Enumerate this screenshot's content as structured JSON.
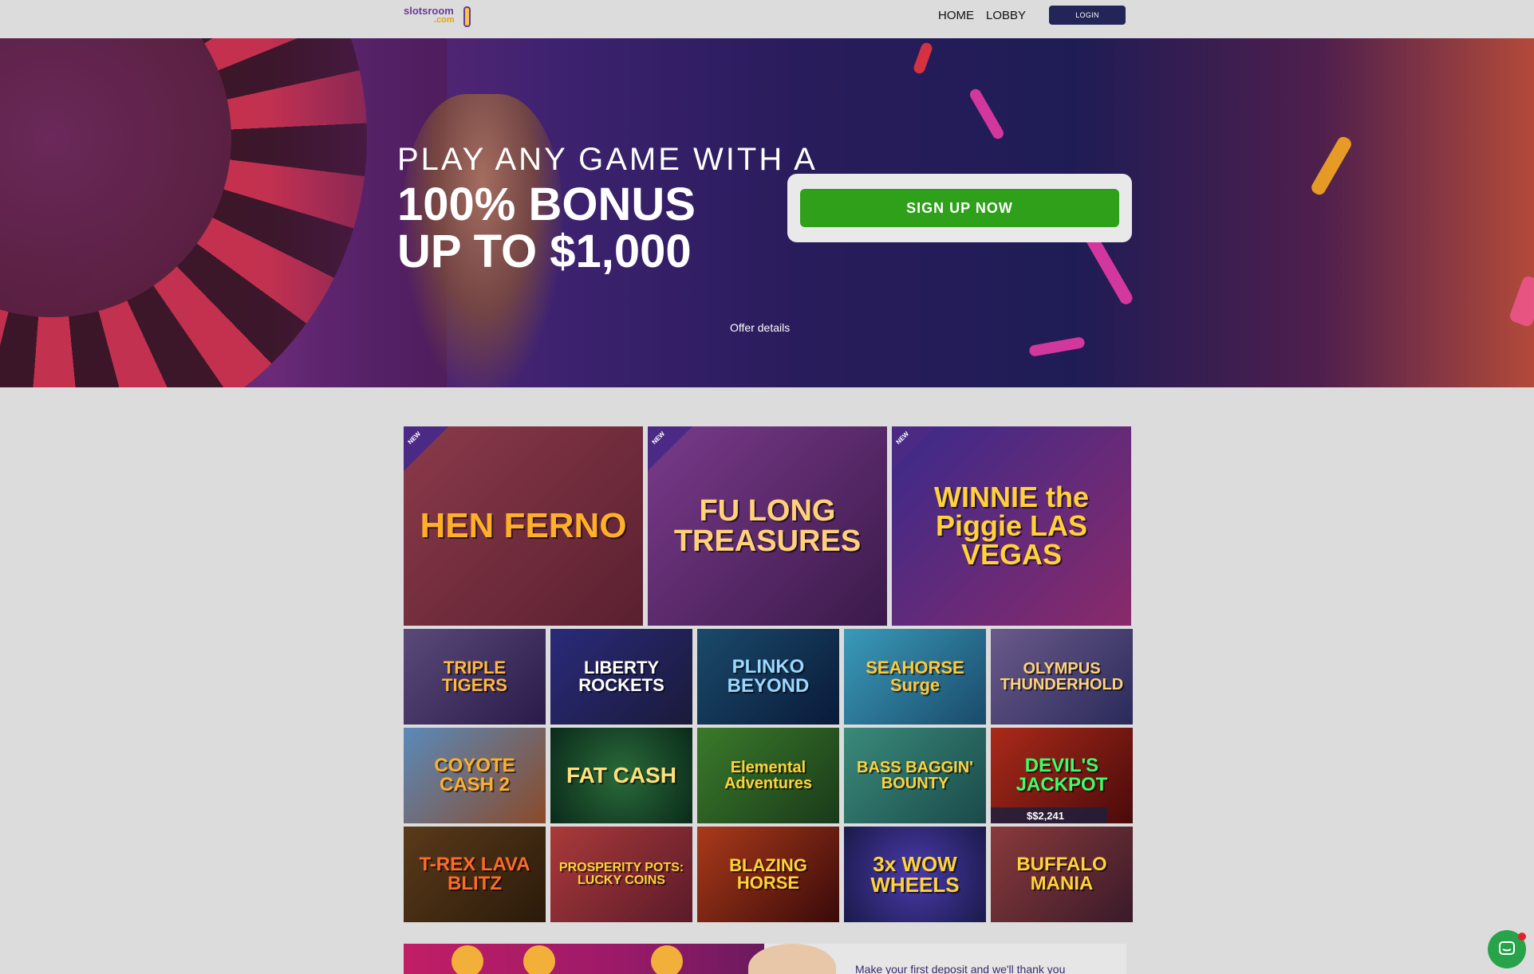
{
  "header": {
    "logo_top": "slotsroom",
    "logo_bottom": ".com",
    "nav": {
      "home": "HOME",
      "lobby": "LOBBY"
    },
    "login": "LOGIN"
  },
  "hero": {
    "line1": "PLAY ANY GAME WITH A",
    "line2": "100% BONUS",
    "line3": "UP TO $1,000",
    "cta": "SIGN UP NOW",
    "offer_link": "Offer details"
  },
  "games": {
    "featured": [
      {
        "title": "HEN FERNO",
        "badge": "NEW",
        "color": "#7a2a3a"
      },
      {
        "title": "FU LONG TREASURES",
        "badge": "NEW",
        "color": "#5a2a6a"
      },
      {
        "title": "WINNIE the Piggie LAS VEGAS",
        "badge": "NEW",
        "color": "#4a2070"
      }
    ],
    "grid": [
      {
        "title": "TRIPLE TIGERS",
        "color": "#4a3a6a"
      },
      {
        "title": "LIBERTY ROCKETS",
        "color": "#2a2a6a"
      },
      {
        "title": "PLINKO BEYOND",
        "color": "#1a3a5a"
      },
      {
        "title": "SEAHORSE Surge",
        "color": "#2a6a8a"
      },
      {
        "title": "OLYMPUS THUNDERHOLD",
        "color": "#4a3a6a"
      },
      {
        "title": "COYOTE CASH 2",
        "color": "#7a4a3a"
      },
      {
        "title": "FAT CASH",
        "color": "#1a4a2a"
      },
      {
        "title": "Elemental Adventures",
        "color": "#2a5a2a"
      },
      {
        "title": "BASS BAGGIN' BOUNTY",
        "color": "#2a5a5a"
      },
      {
        "title": "DEVIL'S JACKPOT",
        "color": "#8a1a1a",
        "jackpot": "$$2,241"
      },
      {
        "title": "T-REX LAVA BLITZ",
        "color": "#3a2a1a"
      },
      {
        "title": "PROSPERITY POTS: LUCKY COINS",
        "color": "#6a2a3a"
      },
      {
        "title": "BLAZING HORSE",
        "color": "#5a1a1a"
      },
      {
        "title": "3x WOW WHEELS",
        "color": "#2a2a6a"
      },
      {
        "title": "BUFFALO MANIA",
        "color": "#5a2a2a"
      }
    ]
  },
  "promo": {
    "text": "Make your first deposit and we'll thank you"
  },
  "chat": {
    "icon": "chat-icon",
    "accent": "#28a34a"
  }
}
